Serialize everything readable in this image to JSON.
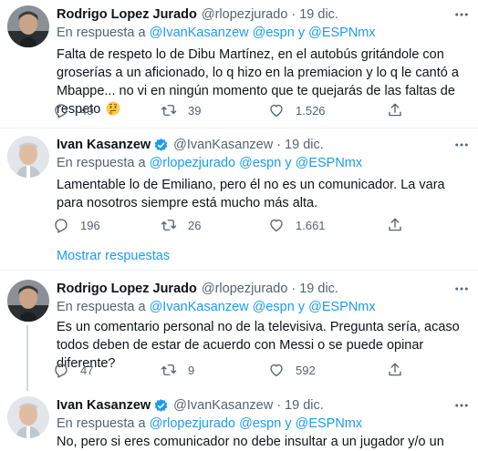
{
  "show_replies_label": "Mostrar respuestas",
  "colors": {
    "link": "#1d9bf0",
    "muted": "#536471",
    "text": "#0f1419",
    "divider": "#eff3f4"
  },
  "tweets": [
    {
      "name": "Rodrigo Lopez Jurado",
      "handle": "@rlopezjurado",
      "sep": "·",
      "date": "19 dic.",
      "verified": false,
      "reply_prefix": "En respuesta a",
      "reply_mentions": "@IvanKasanzew @espn y @ESPNmx",
      "text": "Falta de respeto lo de Dibu Martínez, en el autobús gritándole con groserías a un aficionado, lo q hizo en la premiacion y lo q le cantó a Mbappe... no vi en ningún momento que te quejarás de las faltas de respeto",
      "emoji": "thinking-face",
      "replies": "49",
      "retweets": "39",
      "likes": "1.526"
    },
    {
      "name": "Ivan Kasanzew",
      "handle": "@IvanKasanzew",
      "sep": "·",
      "date": "19 dic.",
      "verified": true,
      "reply_prefix": "En respuesta a",
      "reply_mentions": "@rlopezjurado @espn y @ESPNmx",
      "text": "Lamentable lo de Emiliano, pero él no es un comunicador. La vara para nosotros siempre está mucho más alta.",
      "replies": "196",
      "retweets": "26",
      "likes": "1.661"
    },
    {
      "name": "Rodrigo Lopez Jurado",
      "handle": "@rlopezjurado",
      "sep": "·",
      "date": "19 dic.",
      "verified": false,
      "reply_prefix": "En respuesta a",
      "reply_mentions": "@IvanKasanzew @espn y @ESPNmx",
      "text": "Es un comentario personal no de la televisiva. Pregunta sería, acaso todos deben de estar de acuerdo con Messi o se puede opinar diferente?",
      "replies": "47",
      "retweets": "9",
      "likes": "592"
    },
    {
      "name": "Ivan Kasanzew",
      "handle": "@IvanKasanzew",
      "sep": "·",
      "date": "19 dic.",
      "verified": true,
      "reply_prefix": "En respuesta a",
      "reply_mentions": "@rlopezjurado @espn y @ESPNmx",
      "text": "No, pero si eres comunicador no debe insultar a un jugador y/o un país."
    }
  ]
}
